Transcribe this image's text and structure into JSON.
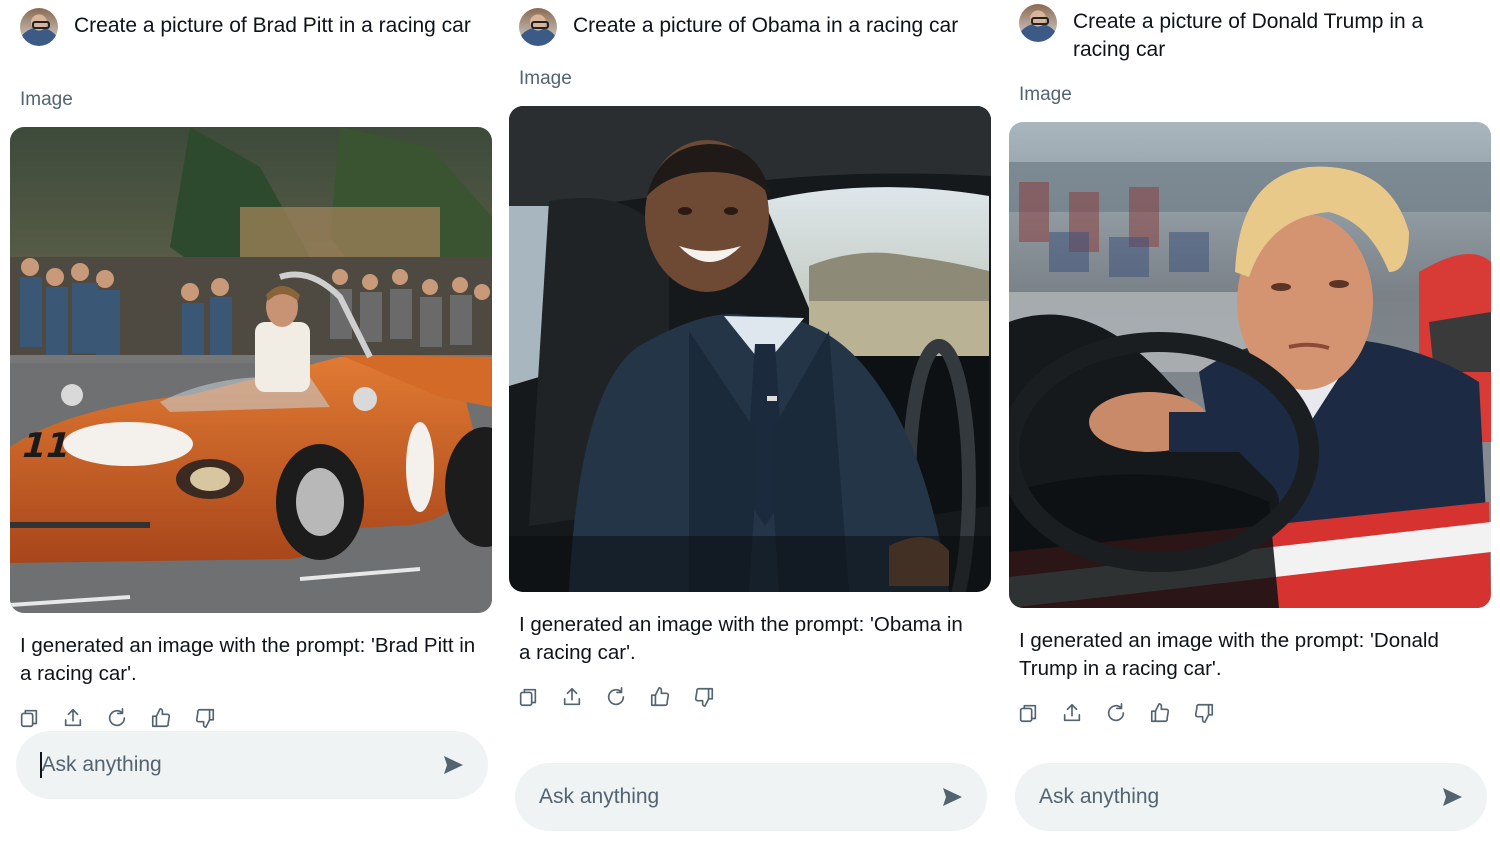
{
  "panels": [
    {
      "prompt": "Create a picture of Brad Pitt in a racing car",
      "image_label": "Image",
      "image_alt": "Brad Pitt driving an orange number 11 racing car past spectators",
      "reply": "I generated an image with the prompt: 'Brad Pitt in a racing car'.",
      "input_placeholder": "Ask anything"
    },
    {
      "prompt": "Create a picture of Obama in a racing car",
      "image_label": "Image",
      "image_alt": "Obama smiling in a suit inside a car",
      "reply": "I generated an image with the prompt: 'Obama in a racing car'.",
      "input_placeholder": "Ask anything"
    },
    {
      "prompt": "Create a picture of Donald Trump in a racing car",
      "image_label": "Image",
      "image_alt": "Donald Trump seated in a red and white racing car",
      "reply": "I generated an image with the prompt: 'Donald Trump in a racing car'.",
      "input_placeholder": "Ask anything"
    }
  ],
  "actions": [
    "copy-icon",
    "share-icon",
    "regenerate-icon",
    "thumbs-up-icon",
    "thumbs-down-icon"
  ],
  "colors": {
    "muted": "#536471",
    "text": "#0f1419",
    "input_bg": "#eff3f4"
  }
}
